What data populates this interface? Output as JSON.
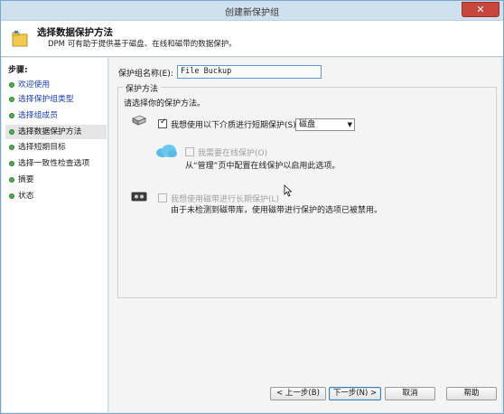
{
  "window": {
    "title": "创建新保护组",
    "close_glyph": "✕"
  },
  "header": {
    "title": "选择数据保护方法",
    "description": "DPM 可有助于提供基于磁盘、在线和磁带的数据保护。",
    "icon": "folder-icon"
  },
  "sidebar": {
    "label": "步骤:",
    "items": [
      {
        "label": "欢迎使用",
        "state": "link"
      },
      {
        "label": "选择保护组类型",
        "state": "link"
      },
      {
        "label": "选择组成员",
        "state": "link"
      },
      {
        "label": "选择数据保护方法",
        "state": "current"
      },
      {
        "label": "选择短期目标",
        "state": "plain"
      },
      {
        "label": "选择一致性检查选项",
        "state": "plain"
      },
      {
        "label": "摘要",
        "state": "plain"
      },
      {
        "label": "状态",
        "state": "plain"
      }
    ]
  },
  "form": {
    "name_label": "保护组名称(E):",
    "name_value": "File Buckup",
    "group_title": "保护方法",
    "group_hint": "请选择你的保护方法。",
    "short_term": {
      "label": "我想使用以下介质进行短期保护(S):",
      "checked": true,
      "selected": "磁盘",
      "icon": "disk-icon"
    },
    "online": {
      "label": "我需要在线保护(O)",
      "checked": false,
      "disabled": true,
      "note": "从“管理”页中配置在线保护以启用此选项。",
      "icon": "cloud-icon"
    },
    "long_term": {
      "label": "我想使用磁带进行长期保护(L)",
      "checked": false,
      "disabled": true,
      "note": "由于未检测到磁带库，使用磁带进行保护的选项已被禁用。",
      "icon": "tape-icon"
    }
  },
  "footer": {
    "back": "< 上一步(B)",
    "next": "下一步(N) >",
    "cancel": "取消",
    "help": "帮助"
  },
  "colors": {
    "link": "#1a3fb6",
    "step_dot": "#4caf50",
    "close": "#c7473c",
    "input_border": "#5a9bd8"
  }
}
